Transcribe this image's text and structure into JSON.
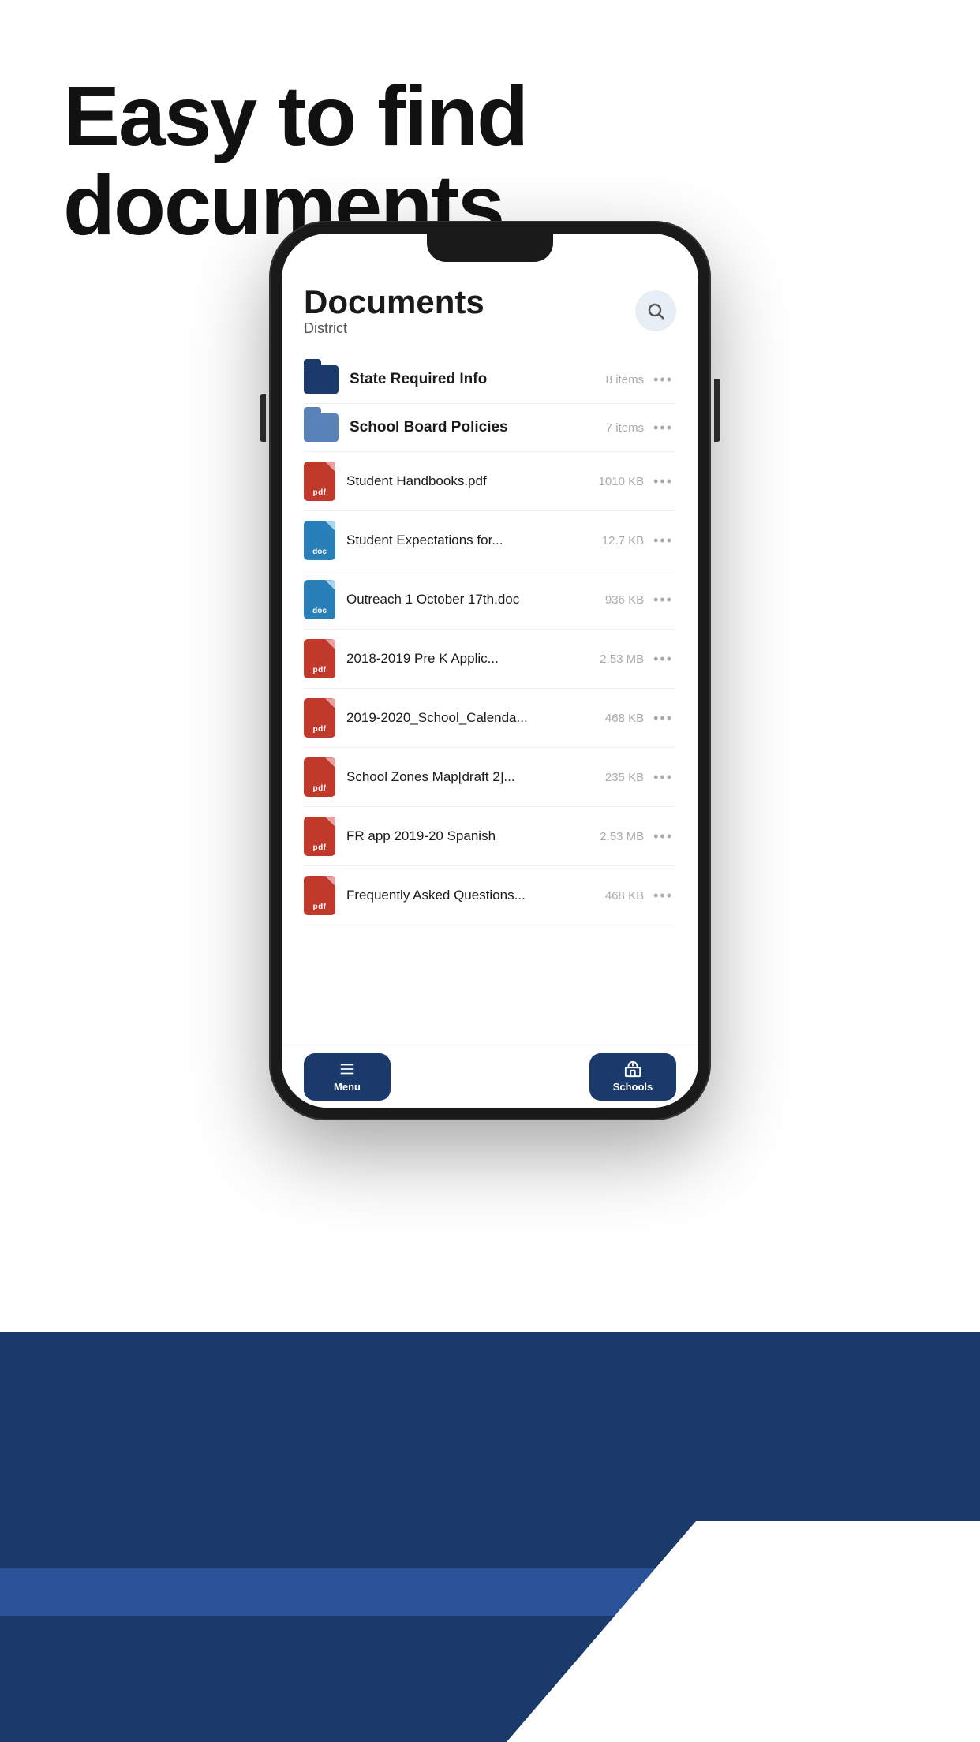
{
  "page": {
    "headline": "Easy to find documents",
    "bg_color": "#1a3a6b"
  },
  "app": {
    "title": "Documents",
    "subtitle": "District",
    "search_icon": "search",
    "folders": [
      {
        "name": "State Required Info",
        "count": "8 items",
        "type": "folder-dark"
      },
      {
        "name": "School Board Policies",
        "count": "7 items",
        "type": "folder-light"
      }
    ],
    "files": [
      {
        "name": "Student Handbooks.pdf",
        "size": "1010 KB",
        "type": "pdf"
      },
      {
        "name": "Student Expectations for...",
        "size": "12.7 KB",
        "type": "doc"
      },
      {
        "name": "Outreach 1 October 17th.doc",
        "size": "936 KB",
        "type": "doc"
      },
      {
        "name": "2018-2019 Pre K Applic...",
        "size": "2.53 MB",
        "type": "pdf"
      },
      {
        "name": "2019-2020_School_Calenda...",
        "size": "468 KB",
        "type": "pdf"
      },
      {
        "name": "School Zones Map[draft 2]...",
        "size": "235 KB",
        "type": "pdf"
      },
      {
        "name": "FR app 2019-20 Spanish",
        "size": "2.53 MB",
        "type": "pdf"
      },
      {
        "name": "Frequently Asked Questions...",
        "size": "468 KB",
        "type": "pdf"
      }
    ],
    "nav": {
      "menu_label": "Menu",
      "schools_label": "Schools"
    }
  }
}
